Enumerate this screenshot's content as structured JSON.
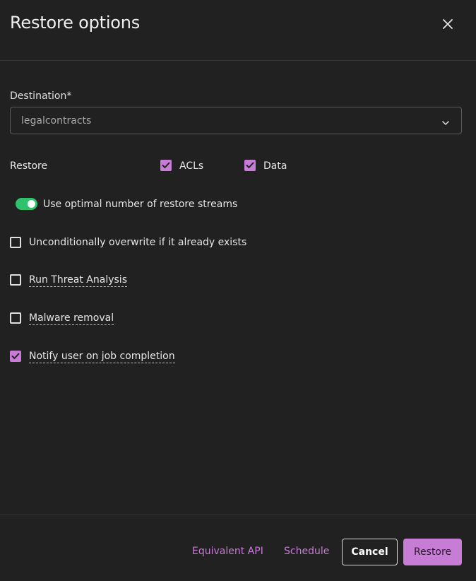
{
  "dialog": {
    "title": "Restore options"
  },
  "destination": {
    "label": "Destination",
    "required_mark": "*",
    "value": "legalcontracts"
  },
  "restore": {
    "label": "Restore",
    "acls_label": "ACLs",
    "acls_checked": true,
    "data_label": "Data",
    "data_checked": true
  },
  "streams_toggle": {
    "label": "Use optimal number of restore streams",
    "on": true
  },
  "options": {
    "overwrite_label": "Unconditionally overwrite if it already exists",
    "overwrite_checked": false,
    "threat_label": "Run Threat Analysis",
    "threat_checked": false,
    "malware_label": "Malware removal",
    "malware_checked": false,
    "notify_label": "Notify user on job completion",
    "notify_checked": true
  },
  "footer": {
    "api_label": "Equivalent API",
    "schedule_label": "Schedule",
    "cancel_label": "Cancel",
    "restore_label": "Restore"
  },
  "colors": {
    "background": "#212121",
    "accent": "#c77dd6",
    "toggle_on": "#2fc26d",
    "divider": "#353535"
  },
  "icons": {
    "close": "close-icon",
    "dropdown": "chevron-down-icon",
    "check": "checkmark-icon"
  }
}
